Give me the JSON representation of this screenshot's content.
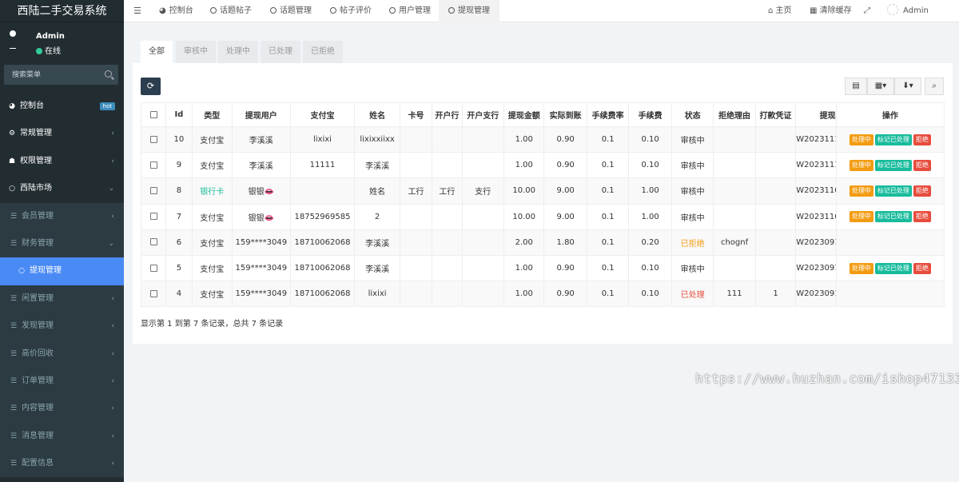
{
  "app": {
    "title": "西陆二手交易系统"
  },
  "user": {
    "name": "Admin",
    "status": "在线"
  },
  "search": {
    "placeholder": "搜索菜单"
  },
  "menu": [
    {
      "label": "控制台",
      "icon": "dashboard-icon",
      "badge": "hot"
    },
    {
      "label": "常规管理",
      "icon": "cogs-icon"
    },
    {
      "label": "权限管理",
      "icon": "group-icon"
    },
    {
      "label": "西陆市场",
      "icon": "circle-icon"
    },
    {
      "label": "会员管理",
      "icon": "list-icon"
    },
    {
      "label": "财务管理",
      "icon": "list-icon"
    },
    {
      "label": "提现管理",
      "icon": "circle-icon"
    },
    {
      "label": "闲置管理",
      "icon": "list-icon"
    },
    {
      "label": "发现管理",
      "icon": "list-icon"
    },
    {
      "label": "高价回收",
      "icon": "list-icon"
    },
    {
      "label": "订单管理",
      "icon": "list-icon"
    },
    {
      "label": "内容管理",
      "icon": "list-icon"
    },
    {
      "label": "消息管理",
      "icon": "list-icon"
    },
    {
      "label": "配置信息",
      "icon": "list-icon"
    }
  ],
  "topnav": {
    "tabs": [
      "控制台",
      "话题帖子",
      "话题管理",
      "帖子评价",
      "用户管理",
      "提现管理"
    ],
    "home": "主页",
    "clear_cache": "清除缓存",
    "admin": "Admin"
  },
  "filter_tabs": [
    "全部",
    "审核中",
    "处理中",
    "已处理",
    "已拒绝"
  ],
  "table": {
    "headers": [
      "Id",
      "类型",
      "提现用户",
      "支付宝",
      "姓名",
      "卡号",
      "开户行",
      "开户支行",
      "提现金额",
      "实际到账",
      "手续费率",
      "手续费",
      "状态",
      "拒绝理由",
      "打款凭证",
      "提现",
      "操作"
    ],
    "rows": [
      {
        "id": "10",
        "type": "支付宝",
        "user": "李溪溪",
        "alipay": "lixixi",
        "name": "lixixxiixx",
        "card": "",
        "bank": "",
        "branch": "",
        "amount": "1.00",
        "actual": "0.90",
        "rate": "0.1",
        "fee": "0.10",
        "status": "审核中",
        "reason": "",
        "voucher": "",
        "sn": "W2023111",
        "ops": true
      },
      {
        "id": "9",
        "type": "支付宝",
        "user": "李溪溪",
        "alipay": "11111",
        "name": "李溪溪",
        "card": "",
        "bank": "",
        "branch": "",
        "amount": "1.00",
        "actual": "0.90",
        "rate": "0.1",
        "fee": "0.10",
        "status": "审核中",
        "reason": "",
        "voucher": "",
        "sn": "W2023111",
        "ops": true
      },
      {
        "id": "8",
        "type": "银行卡",
        "user": "银银👄",
        "alipay": "",
        "name": "姓名",
        "card": "工行",
        "bank": "工行",
        "branch": "支行",
        "amount": "10.00",
        "actual": "9.00",
        "rate": "0.1",
        "fee": "1.00",
        "status": "审核中",
        "reason": "",
        "voucher": "",
        "sn": "W2023110",
        "ops": true
      },
      {
        "id": "7",
        "type": "支付宝",
        "user": "银银👄",
        "alipay": "18752969585",
        "name": "2",
        "card": "",
        "bank": "",
        "branch": "",
        "amount": "10.00",
        "actual": "9.00",
        "rate": "0.1",
        "fee": "1.00",
        "status": "审核中",
        "reason": "",
        "voucher": "",
        "sn": "W2023110",
        "ops": true
      },
      {
        "id": "6",
        "type": "支付宝",
        "user": "159****3049",
        "alipay": "18710062068",
        "name": "李溪溪",
        "card": "",
        "bank": "",
        "branch": "",
        "amount": "2.00",
        "actual": "1.80",
        "rate": "0.1",
        "fee": "0.20",
        "status": "已拒绝",
        "reason": "chognf",
        "voucher": "",
        "sn": "W2023091",
        "ops": false
      },
      {
        "id": "5",
        "type": "支付宝",
        "user": "159****3049",
        "alipay": "18710062068",
        "name": "李溪溪",
        "card": "",
        "bank": "",
        "branch": "",
        "amount": "1.00",
        "actual": "0.90",
        "rate": "0.1",
        "fee": "0.10",
        "status": "审核中",
        "reason": "",
        "voucher": "",
        "sn": "W2023091",
        "ops": true
      },
      {
        "id": "4",
        "type": "支付宝",
        "user": "159****3049",
        "alipay": "18710062068",
        "name": "lixixi",
        "card": "",
        "bank": "",
        "branch": "",
        "amount": "1.00",
        "actual": "0.90",
        "rate": "0.1",
        "fee": "0.10",
        "status": "已处理",
        "reason": "111",
        "voucher": "1",
        "sn": "W2023091",
        "ops": false
      }
    ],
    "op_labels": {
      "processing": "处理中",
      "mark_done": "标记已处理",
      "reject": "拒绝"
    }
  },
  "pagination_info": "显示第 1 到第 7 条记录，总共 7 条记录",
  "watermark": "https://www.huzhan.com/ishop47133",
  "colors": {
    "sidebar": "#222d32",
    "active_menu": "#4a8af4",
    "green": "#18bc9c",
    "orange": "#f39c12",
    "red": "#e74c3c"
  }
}
